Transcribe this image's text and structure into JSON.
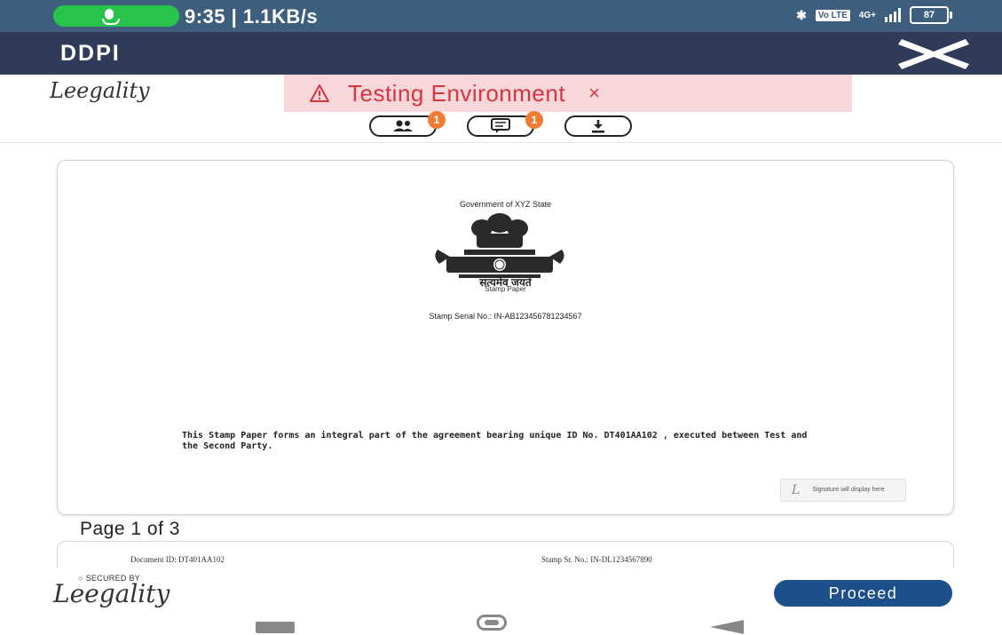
{
  "status_bar": {
    "time_speed": "9:35 | 1.1KB/s",
    "network": "4G+",
    "volte": "Vo LTE",
    "battery": "87"
  },
  "app_bar": {
    "title": "DDPI"
  },
  "header": {
    "logo": "Leegality",
    "banner_text": "Testing Environment",
    "banner_close": "×"
  },
  "actions": {
    "signers_badge": "1",
    "comments_badge": "1"
  },
  "document": {
    "government": "Government of XYZ State",
    "motto": "सत्यमेव जयते",
    "stamp_paper": "Stamp Paper",
    "serial": "Stamp Serial No.: IN-AB123456781234567",
    "body": "This Stamp Paper forms an integral part of the agreement bearing unique ID No. DT401AA102 , executed between Test and the Second Party.",
    "signature_placeholder": "Signature will display here",
    "signature_icon": "L"
  },
  "pagination": {
    "label": "Page 1 of 3"
  },
  "page2": {
    "document_id": "Document ID: DT401AA102",
    "stamp_sr": "Stamp Sr. No.: IN-DL1234567890"
  },
  "footer": {
    "secured_by": "SECURED BY",
    "logo": "Leegality",
    "proceed_label": "Proceed"
  },
  "colors": {
    "status_bar": "#3d5f7d",
    "app_bar": "#2f3b58",
    "banner_bg": "#f8d7da",
    "banner_text": "#d8343f",
    "badge": "#f07b33",
    "proceed": "#1d4f8a"
  }
}
